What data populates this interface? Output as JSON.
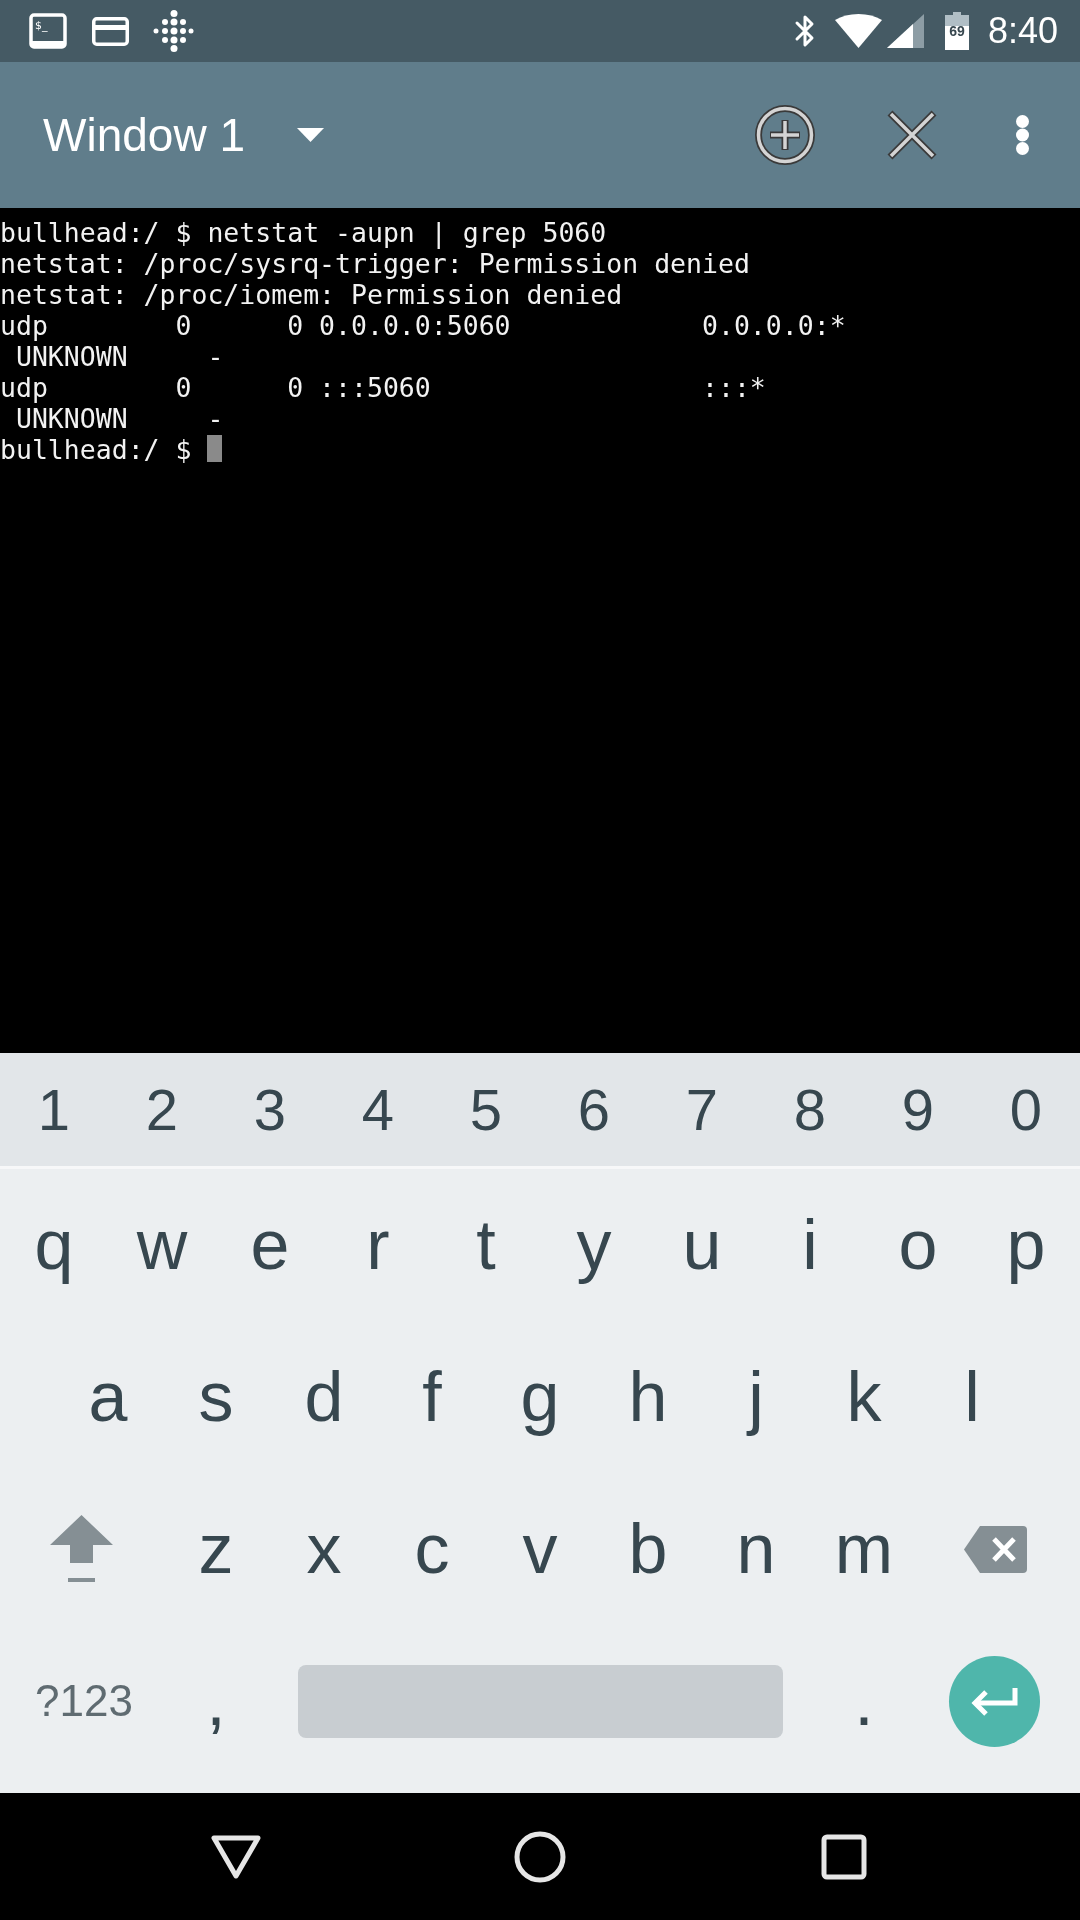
{
  "status_bar": {
    "terminal_icon_text": "$_",
    "battery_text": "69",
    "time": "8:40"
  },
  "toolbar": {
    "title": "Window 1"
  },
  "terminal": {
    "lines": [
      "bullhead:/ $ netstat -aupn | grep 5060",
      "netstat: /proc/sysrq-trigger: Permission denied",
      "netstat: /proc/iomem: Permission denied",
      "udp        0      0 0.0.0.0:5060            0.0.0.0:*",
      " UNKNOWN     -",
      "udp        0      0 :::5060                 :::*",
      " UNKNOWN     -",
      "bullhead:/ $ "
    ]
  },
  "keyboard": {
    "number_row": [
      "1",
      "2",
      "3",
      "4",
      "5",
      "6",
      "7",
      "8",
      "9",
      "0"
    ],
    "rows": [
      [
        "q",
        "w",
        "e",
        "r",
        "t",
        "y",
        "u",
        "i",
        "o",
        "p"
      ],
      [
        "a",
        "s",
        "d",
        "f",
        "g",
        "h",
        "j",
        "k",
        "l"
      ],
      [
        "z",
        "x",
        "c",
        "v",
        "b",
        "n",
        "m"
      ]
    ],
    "symbols_key": "?123",
    "comma_key": ",",
    "period_key": "."
  }
}
